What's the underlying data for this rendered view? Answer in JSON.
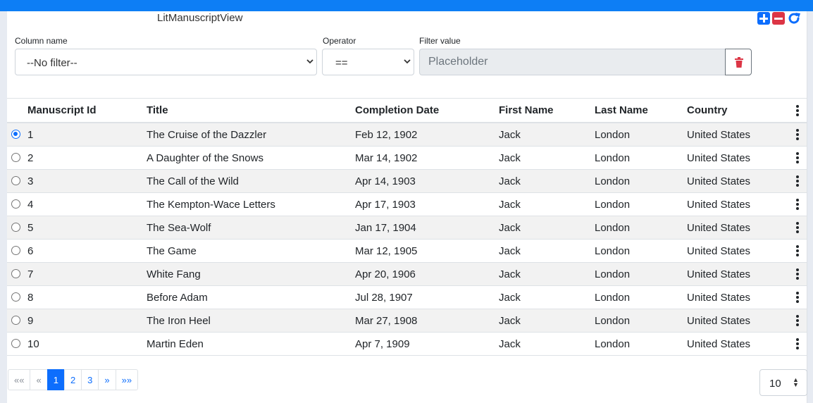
{
  "app": {
    "title": "LitManuscriptView"
  },
  "toolbar": {
    "add_icon": "plus-square-icon",
    "remove_icon": "minus-square-icon",
    "refresh_icon": "refresh-icon"
  },
  "filter": {
    "column_label": "Column name",
    "column_value": "--No filter--",
    "operator_label": "Operator",
    "operator_value": "==",
    "value_label": "Filter value",
    "value_placeholder": "Placeholder",
    "clear_icon": "trash-icon"
  },
  "table": {
    "headers": [
      "Manuscript Id",
      "Title",
      "Completion Date",
      "First Name",
      "Last Name",
      "Country"
    ],
    "selected_index": 0,
    "rows": [
      {
        "id": "1",
        "title": "The Cruise of the Dazzler",
        "date": "Feb 12, 1902",
        "first": "Jack",
        "last": "London",
        "country": "United States"
      },
      {
        "id": "2",
        "title": "A Daughter of the Snows",
        "date": "Mar 14, 1902",
        "first": "Jack",
        "last": "London",
        "country": "United States"
      },
      {
        "id": "3",
        "title": "The Call of the Wild",
        "date": "Apr 14, 1903",
        "first": "Jack",
        "last": "London",
        "country": "United States"
      },
      {
        "id": "4",
        "title": "The Kempton-Wace Letters",
        "date": "Apr 17, 1903",
        "first": "Jack",
        "last": "London",
        "country": "United States"
      },
      {
        "id": "5",
        "title": "The Sea-Wolf",
        "date": "Jan 17, 1904",
        "first": "Jack",
        "last": "London",
        "country": "United States"
      },
      {
        "id": "6",
        "title": "The Game",
        "date": "Mar 12, 1905",
        "first": "Jack",
        "last": "London",
        "country": "United States"
      },
      {
        "id": "7",
        "title": "White Fang",
        "date": "Apr 20, 1906",
        "first": "Jack",
        "last": "London",
        "country": "United States"
      },
      {
        "id": "8",
        "title": "Before Adam",
        "date": "Jul 28, 1907",
        "first": "Jack",
        "last": "London",
        "country": "United States"
      },
      {
        "id": "9",
        "title": "The Iron Heel",
        "date": "Mar 27, 1908",
        "first": "Jack",
        "last": "London",
        "country": "United States"
      },
      {
        "id": "10",
        "title": "Martin Eden",
        "date": "Apr 7, 1909",
        "first": "Jack",
        "last": "London",
        "country": "United States"
      }
    ]
  },
  "pagination": {
    "first": "««",
    "prev": "«",
    "pages": [
      "1",
      "2",
      "3"
    ],
    "current_page": "1",
    "next": "»",
    "last": "»»",
    "page_size": "10"
  },
  "colors": {
    "accent": "#0d6efd",
    "topbar": "#0d7ef5",
    "danger": "#dc3545",
    "row_alt": "#f2f2f2"
  }
}
